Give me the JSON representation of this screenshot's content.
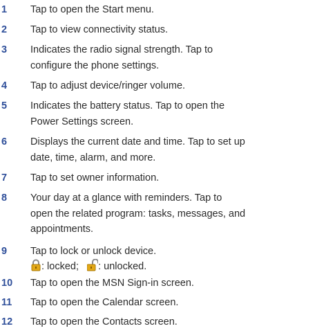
{
  "items": [
    {
      "num": "1",
      "text": "Tap to open the Start menu."
    },
    {
      "num": "2",
      "text": "Tap to view connectivity status."
    },
    {
      "num": "3",
      "text": "Indicates the radio signal strength. Tap to\nconfigure the phone settings."
    },
    {
      "num": "4",
      "text": "Tap to adjust device/ringer volume."
    },
    {
      "num": "5",
      "text": "Indicates the battery status. Tap to open the\nPower Settings screen."
    },
    {
      "num": "6",
      "text": "Displays the current date and time. Tap to set up\ndate, time, alarm, and more."
    },
    {
      "num": "7",
      "text": "Tap to set owner information."
    },
    {
      "num": "8",
      "text": "Your day at a glance with reminders. Tap to\nopen the related program: tasks, messages, and\nappointments."
    },
    {
      "num": "9",
      "text": "Tap to lock or unlock device."
    },
    {
      "num": "10",
      "text": "Tap to open the MSN Sign-in screen."
    },
    {
      "num": "11",
      "text": "Tap to open the Calendar screen."
    },
    {
      "num": "12",
      "text": "Tap to open the Contacts screen."
    }
  ],
  "lock_legend": {
    "locked_icon": "lock-closed-icon",
    "locked_label": ": locked;",
    "unlocked_icon": "lock-open-icon",
    "unlocked_label": ": unlocked."
  },
  "colors": {
    "number": "#2f4f9a",
    "text": "#2b2b2b",
    "lock_body": "#e3a816"
  }
}
